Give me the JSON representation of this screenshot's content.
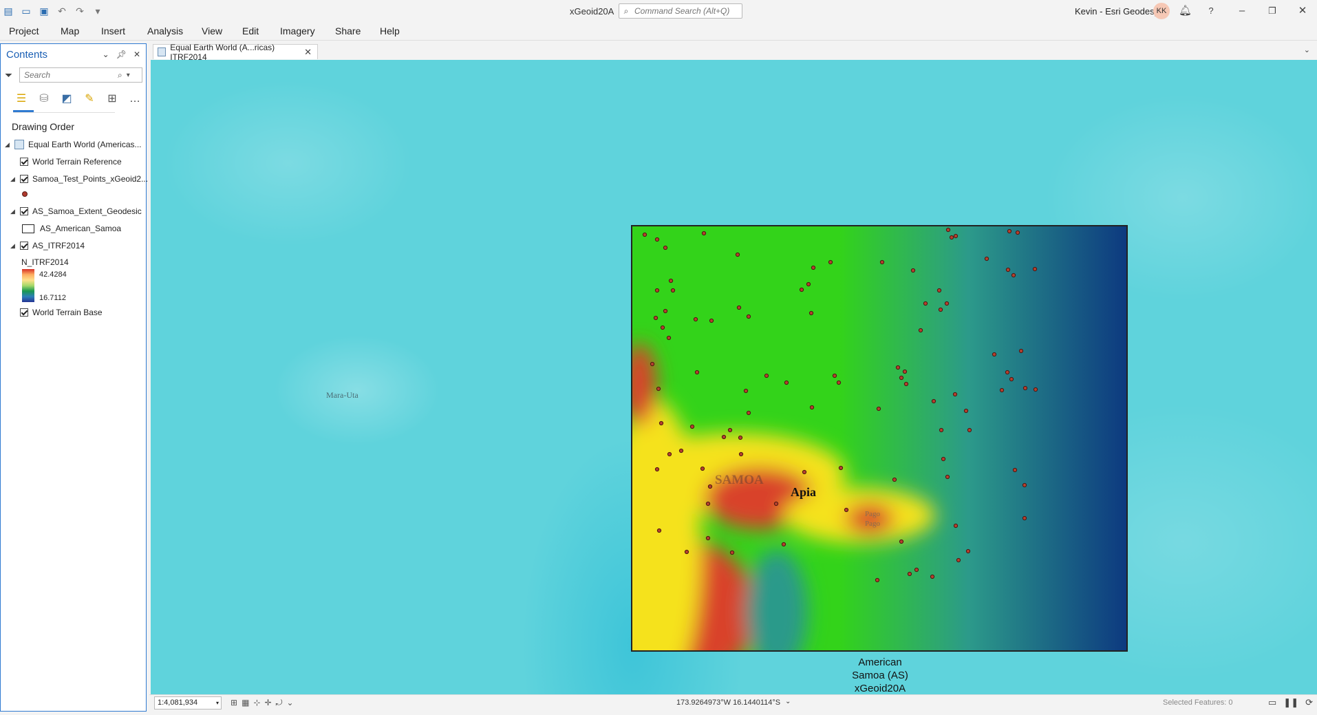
{
  "window": {
    "title": "xGeoid20A",
    "command_search_placeholder": "Command Search (Alt+Q)",
    "user_name": "Kevin - Esri Geodesy",
    "user_initials": "KK"
  },
  "ribbon": {
    "tabs": [
      "Project",
      "Map",
      "Insert",
      "Analysis",
      "View",
      "Edit",
      "Imagery",
      "Share",
      "Help"
    ]
  },
  "contents": {
    "title": "Contents",
    "search_placeholder": "Search",
    "section_label": "Drawing Order",
    "layers": {
      "map_name": "Equal Earth World (Americas...",
      "world_terrain_reference": "World Terrain Reference",
      "test_points": "Samoa_Test_Points_xGeoid2...",
      "extent_layer": "AS_Samoa_Extent_Geodesic",
      "extent_symbol_label": "AS_American_Samoa",
      "raster_layer": "AS_ITRF2014",
      "raster_field": "N_ITRF2014",
      "raster_max": "42.4284",
      "raster_min": "16.7112",
      "world_terrain_base": "World Terrain Base"
    }
  },
  "map_view": {
    "tab_label": "Equal Earth World (A...ricas) ITRF2014",
    "labels": {
      "mara_uti": "Mara-Uta",
      "samoa": "SAMOA",
      "apia": "Apia",
      "pago_pago": "Pago\nPago",
      "extent_label": "American\nSamoa (AS)\nxGeoid20A"
    },
    "raster_colors": {
      "high": "#d9432a",
      "mid_high": "#f5e21a",
      "mid": "#33d31a",
      "mid_low": "#2c9a8a",
      "low": "#0d3a80"
    },
    "point_color": "#b5402e"
  },
  "status_bar": {
    "scale": "1:4,081,934",
    "coordinates": "173.9264973°W 16.1440114°S",
    "selected_features": "Selected Features: 0"
  }
}
